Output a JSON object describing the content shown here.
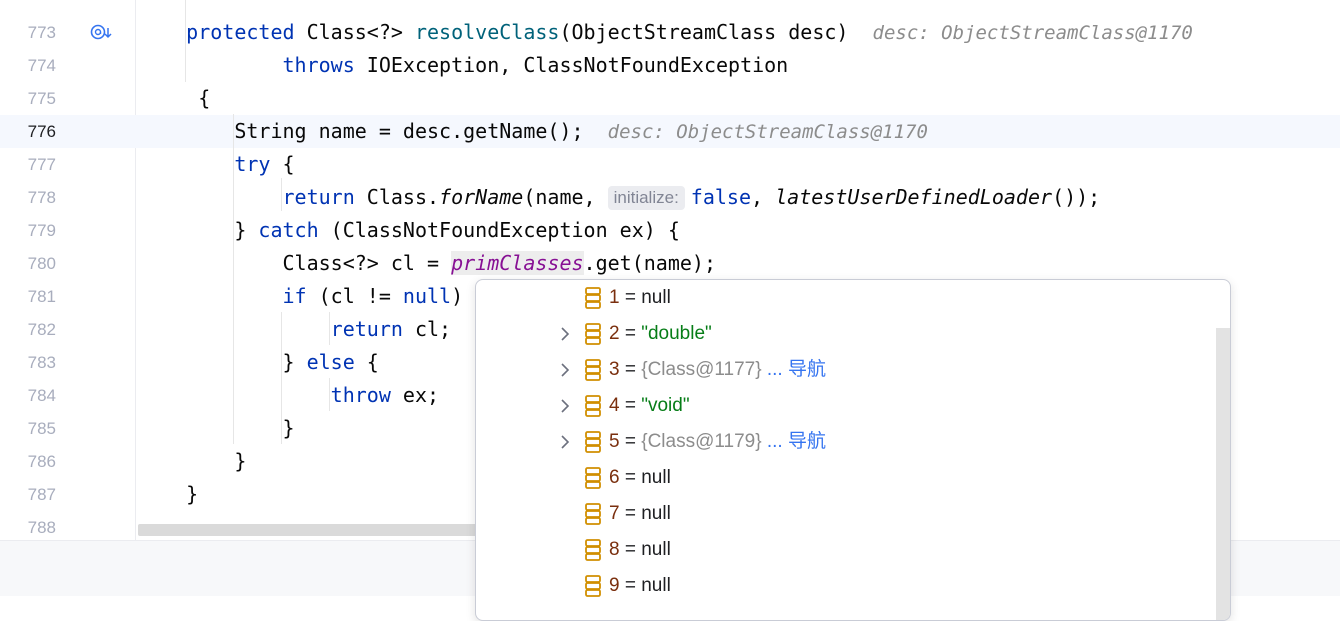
{
  "editor": {
    "lines": [
      {
        "number": "773",
        "indent": "    ",
        "kw1": "protected",
        "t1": " Class<?> ",
        "fn": "resolveClass",
        "t2": "(ObjectStreamClass desc)",
        "hint": "desc: ObjectStreamClass@1170"
      },
      {
        "number": "774",
        "indent": "            ",
        "kw1": "throws",
        "t1": " IOException, ClassNotFoundException"
      },
      {
        "number": "775",
        "indent": "     ",
        "t1": "{"
      },
      {
        "number": "776",
        "indent": "        ",
        "t1": "String name = desc.getName();",
        "hint": "desc: ObjectStreamClass@1170"
      },
      {
        "number": "777",
        "indent": "        ",
        "kw1": "try",
        "t1": " {"
      },
      {
        "number": "778",
        "indent": "            ",
        "kw1": "return",
        "t1": " Class.",
        "call": "forName",
        "t2": "(name,",
        "param_hint": "initialize:",
        "kw2": "false",
        "t3": ", ",
        "call2": "latestUserDefinedLoader",
        "t4": "());"
      },
      {
        "number": "779",
        "indent": "        ",
        "t1": "} ",
        "kw1": "catch",
        "t2": " (ClassNotFoundException ex) {"
      },
      {
        "number": "780",
        "indent": "            ",
        "t1": "Class<?> cl = ",
        "field": "primClasses",
        "t2": ".get(name);"
      },
      {
        "number": "781",
        "indent": "            ",
        "kw1": "if",
        "t1": " (cl != ",
        "kw2": "null",
        "t2": ")"
      },
      {
        "number": "782",
        "indent": "                ",
        "kw1": "return",
        "t1": " cl;"
      },
      {
        "number": "783",
        "indent": "            ",
        "t1": "} ",
        "kw1": "else",
        "t2": " {"
      },
      {
        "number": "784",
        "indent": "                ",
        "kw1": "throw",
        "t1": " ex;"
      },
      {
        "number": "785",
        "indent": "            ",
        "t1": "}"
      },
      {
        "number": "786",
        "indent": "        ",
        "t1": "}"
      },
      {
        "number": "787",
        "indent": "    ",
        "t1": "}"
      },
      {
        "number": "788",
        "indent": "",
        "t1": ""
      }
    ],
    "current_line": "776",
    "gutter_icon": "override-method-icon"
  },
  "popup": {
    "items": [
      {
        "index": "1",
        "eq": " = ",
        "value": "null",
        "type": "null",
        "expandable": false
      },
      {
        "index": "2",
        "eq": " = ",
        "value": "\"double\"",
        "type": "str",
        "expandable": true
      },
      {
        "index": "3",
        "eq": " = ",
        "value": "{Class@1177} ",
        "type": "obj",
        "nav": "... 导航",
        "expandable": true
      },
      {
        "index": "4",
        "eq": " = ",
        "value": "\"void\"",
        "type": "str",
        "expandable": true
      },
      {
        "index": "5",
        "eq": " = ",
        "value": "{Class@1179} ",
        "type": "obj",
        "nav": "... 导航",
        "expandable": true
      },
      {
        "index": "6",
        "eq": " = ",
        "value": "null",
        "type": "null",
        "expandable": false
      },
      {
        "index": "7",
        "eq": " = ",
        "value": "null",
        "type": "null",
        "expandable": false
      },
      {
        "index": "8",
        "eq": " = ",
        "value": "null",
        "type": "null",
        "expandable": false
      },
      {
        "index": "9",
        "eq": " = ",
        "value": "null",
        "type": "null",
        "expandable": false
      }
    ]
  },
  "colors": {
    "keyword": "#0033b3",
    "method": "#00627a",
    "field": "#871094",
    "string": "#067d17",
    "index": "#7a2f0e",
    "link": "#3574f0"
  }
}
